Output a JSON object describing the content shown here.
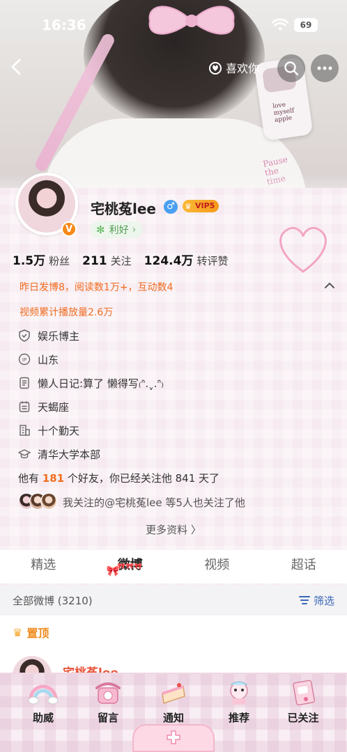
{
  "status_bar": {
    "time": "16:36",
    "battery": "69"
  },
  "top_nav": {
    "like_label": "喜欢你"
  },
  "hero": {
    "phone_text": "love\nmyself\napple",
    "sticker_text": "Pause\nthe\ntime"
  },
  "profile": {
    "username": "宅桃菟lee",
    "gender_symbol": "♂",
    "verified_badge": "V",
    "vip_label": "VIP5",
    "friend_label": "利好",
    "stats": [
      {
        "num": "1.5万",
        "label": "粉丝"
      },
      {
        "num": "211",
        "label": "关注"
      },
      {
        "num": "124.4万",
        "label": "转评赞"
      }
    ],
    "activity_line": "昨日发博8，阅读数1万+，互动数4",
    "video_line": "视频累计播放量2.6万",
    "info_rows": [
      {
        "icon": "verified-shield-icon",
        "text": "娱乐博主"
      },
      {
        "icon": "ip-location-icon",
        "text": "山东"
      },
      {
        "icon": "bio-document-icon",
        "text": "懒人日记:算了 懒得写₍ᐢ.ˬ.ᐢ₎"
      },
      {
        "icon": "calendar-icon",
        "text": "天蝎座"
      },
      {
        "icon": "company-building-icon",
        "text": "十个勤天"
      },
      {
        "icon": "graduation-cap-icon",
        "text": "清华大学本部"
      }
    ],
    "friends_prefix": "他有 ",
    "friends_count": "181",
    "friends_suffix": " 个好友，你已经关注他 841 天了",
    "mutual_text": "我关注的@宅桃菟lee  等5人也关注了他",
    "more_info": "更多资料 〉"
  },
  "tabs": [
    {
      "label": "精选",
      "active": false
    },
    {
      "label": "微博",
      "active": true
    },
    {
      "label": "视频",
      "active": false
    },
    {
      "label": "超话",
      "active": false
    }
  ],
  "tab_decoration": "🎀🎀🎀",
  "filter": {
    "all_label": "全部微博 (3210)",
    "filter_label": "筛选"
  },
  "feed": {
    "pinned_label": "置顶",
    "post_author": "宅桃菟lee"
  },
  "bottom_bar": [
    {
      "label": "助威",
      "icon": "rainbow-cheer-icon"
    },
    {
      "label": "留言",
      "icon": "telephone-message-icon"
    },
    {
      "label": "通知",
      "icon": "cake-notify-icon"
    },
    {
      "label": "推荐",
      "icon": "character-recommend-icon"
    },
    {
      "label": "已关注",
      "icon": "followed-book-icon"
    }
  ],
  "colors": {
    "accent_orange": "#f06c1e",
    "link_blue": "#3a66b8",
    "pink_theme": "#f3b6cc",
    "friend_green": "#4f9a4f"
  }
}
